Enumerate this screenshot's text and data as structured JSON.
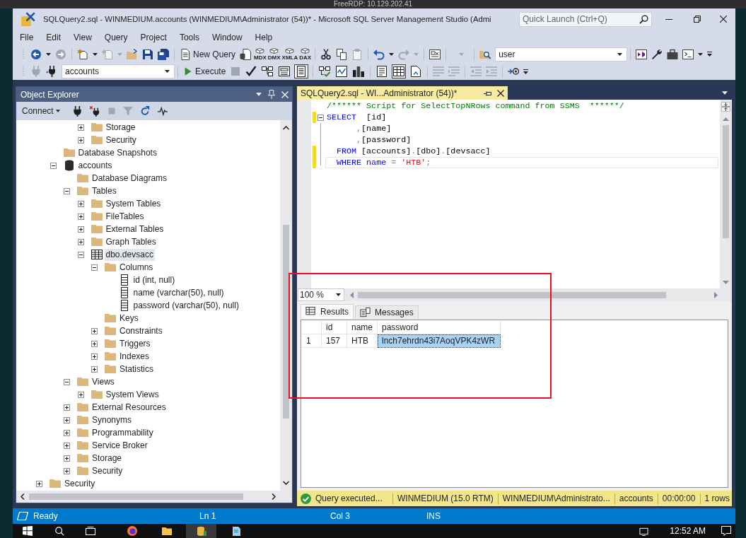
{
  "remote_session": {
    "title": "FreeRDP: 10.129.202.41"
  },
  "window": {
    "title": "SQLQuery2.sql - WINMEDIUM.accounts (WINMEDIUM\\Administrator (54))* - Microsoft SQL Server Management Studio (Admi",
    "quick_launch": {
      "placeholder": "Quick Launch (Ctrl+Q)"
    }
  },
  "menu": [
    "File",
    "Edit",
    "View",
    "Query",
    "Project",
    "Tools",
    "Window",
    "Help"
  ],
  "toolbar": {
    "new_query": "New Query",
    "script_types": [
      "MDX",
      "DMX",
      "XMLA",
      "DAX"
    ],
    "find_value": "user",
    "database": "accounts",
    "execute": "Execute",
    "toggle_groups": [
      {
        "buttons": [
          {
            "kind": "plan",
            "on": false
          },
          {
            "kind": "options",
            "on": false
          },
          {
            "kind": "intellisense",
            "on": true
          }
        ]
      },
      {
        "buttons": [
          {
            "kind": "actual_plan",
            "on": false
          },
          {
            "kind": "live_stats",
            "on": false
          },
          {
            "kind": "client_stats",
            "on": false
          }
        ]
      },
      {
        "buttons": [
          {
            "kind": "results_text",
            "on": false
          },
          {
            "kind": "results_grid",
            "on": true
          },
          {
            "kind": "results_file",
            "on": false
          }
        ]
      }
    ]
  },
  "object_explorer": {
    "title": "Object Explorer",
    "connect": "Connect",
    "tree": [
      {
        "children": [
          {
            "children": [
              {
                "children": [
                  {
                    "children": [
                      {
                        "label": "Storage",
                        "kind": "folder",
                        "expanded": false,
                        "selected": false
                      },
                      {
                        "label": "Security",
                        "kind": "folder",
                        "expanded": false,
                        "selected": false
                      }
                    ]
                  }
                ]
              },
              {
                "label": "Database Snapshots",
                "kind": "folder",
                "selected": false
              },
              {
                "label": "accounts",
                "kind": "database",
                "expanded": true,
                "selected": false,
                "children": [
                  {
                    "label": "Database Diagrams",
                    "kind": "folder",
                    "selected": false
                  },
                  {
                    "label": "Tables",
                    "kind": "folder",
                    "expanded": true,
                    "selected": false,
                    "children": [
                      {
                        "label": "System Tables",
                        "kind": "folder",
                        "expanded": false,
                        "selected": false
                      },
                      {
                        "label": "FileTables",
                        "kind": "folder",
                        "expanded": false,
                        "selected": false
                      },
                      {
                        "label": "External Tables",
                        "kind": "folder",
                        "expanded": false,
                        "selected": false
                      },
                      {
                        "label": "Graph Tables",
                        "kind": "folder",
                        "expanded": false,
                        "selected": false
                      },
                      {
                        "label": "dbo.devsacc",
                        "kind": "table",
                        "expanded": true,
                        "selected": true,
                        "children": [
                          {
                            "label": "Columns",
                            "kind": "folder",
                            "expanded": true,
                            "selected": false,
                            "children": [
                              {
                                "label": "id (int, null)",
                                "kind": "column",
                                "selected": false
                              },
                              {
                                "label": "name (varchar(50), null)",
                                "kind": "column",
                                "selected": false
                              },
                              {
                                "label": "password (varchar(50), null)",
                                "kind": "column",
                                "selected": false
                              }
                            ]
                          },
                          {
                            "label": "Keys",
                            "kind": "folder",
                            "selected": false
                          },
                          {
                            "label": "Constraints",
                            "kind": "folder",
                            "expanded": false,
                            "selected": false
                          },
                          {
                            "label": "Triggers",
                            "kind": "folder",
                            "expanded": false,
                            "selected": false
                          },
                          {
                            "label": "Indexes",
                            "kind": "folder",
                            "expanded": false,
                            "selected": false
                          },
                          {
                            "label": "Statistics",
                            "kind": "folder",
                            "expanded": false,
                            "selected": false
                          }
                        ]
                      }
                    ]
                  },
                  {
                    "label": "Views",
                    "kind": "folder",
                    "expanded": true,
                    "selected": false,
                    "children": [
                      {
                        "label": "System Views",
                        "kind": "folder",
                        "expanded": false,
                        "selected": false
                      }
                    ]
                  },
                  {
                    "label": "External Resources",
                    "kind": "folder",
                    "expanded": false,
                    "selected": false
                  },
                  {
                    "label": "Synonyms",
                    "kind": "folder",
                    "expanded": false,
                    "selected": false
                  },
                  {
                    "label": "Programmability",
                    "kind": "folder",
                    "expanded": false,
                    "selected": false
                  },
                  {
                    "label": "Service Broker",
                    "kind": "folder",
                    "expanded": false,
                    "selected": false
                  },
                  {
                    "label": "Storage",
                    "kind": "folder",
                    "expanded": false,
                    "selected": false
                  },
                  {
                    "label": "Security",
                    "kind": "folder",
                    "expanded": false,
                    "selected": false
                  }
                ]
              }
            ]
          },
          {
            "label": "Security",
            "kind": "folder",
            "expanded": false,
            "selected": false
          }
        ]
      }
    ]
  },
  "editor": {
    "tab": {
      "label": "SQLQuery2.sql - WI...Administrator (54))*",
      "selected": true
    },
    "lines": [
      {
        "kind": "plain",
        "changed": false,
        "current": false,
        "tokens": [
          {
            "text": "/****** Script for SelectTopNRows command from SSMS  ******/",
            "kind": "comment"
          }
        ]
      },
      {
        "kind": "fold_start",
        "changed": true,
        "current": false,
        "tokens": [
          {
            "text": "SELECT",
            "kind": "keyword"
          },
          {
            "text": "  [id]",
            "kind": "plain"
          }
        ]
      },
      {
        "kind": "fold_body",
        "changed": false,
        "current": false,
        "tokens": [
          {
            "text": "      ,",
            "kind": "punct"
          },
          {
            "text": "[name]",
            "kind": "plain"
          }
        ]
      },
      {
        "kind": "fold_body",
        "changed": false,
        "current": false,
        "tokens": [
          {
            "text": "      ,",
            "kind": "punct"
          },
          {
            "text": "[password]",
            "kind": "plain"
          }
        ]
      },
      {
        "kind": "fold_body",
        "changed": true,
        "current": false,
        "tokens": [
          {
            "text": "  FROM",
            "kind": "keyword"
          },
          {
            "text": " [accounts]",
            "kind": "plain"
          },
          {
            "text": ".",
            "kind": "punct"
          },
          {
            "text": "[dbo]",
            "kind": "plain"
          },
          {
            "text": ".",
            "kind": "punct"
          },
          {
            "text": "[devsacc]",
            "kind": "plain"
          }
        ]
      },
      {
        "kind": "fold_end",
        "changed": true,
        "current": true,
        "tokens": [
          {
            "text": "  WHERE name",
            "kind": "keyword"
          },
          {
            "text": " =",
            "kind": "punct"
          },
          {
            "text": " 'HTB'",
            "kind": "string"
          },
          {
            "text": ";",
            "kind": "punct"
          }
        ]
      }
    ],
    "zoom": "100 %"
  },
  "results": {
    "tabs": [
      {
        "label": "Results",
        "kind": "grid",
        "selected": true
      },
      {
        "label": "Messages",
        "kind": "messages",
        "selected": false
      }
    ],
    "columns": [
      "id",
      "name",
      "password"
    ],
    "rows": [
      {
        "number": "1",
        "cells": [
          {
            "text": "157",
            "selected": false
          },
          {
            "text": "HTB",
            "selected": false
          },
          {
            "text": "lnch7ehrdn43i7AoqVPK4zWR",
            "selected": true
          }
        ]
      }
    ]
  },
  "query_status": {
    "message": "Query executed...",
    "fields": [
      "WINMEDIUM (15.0 RTM)",
      "WINMEDIUM\\Administrato...",
      "accounts",
      "00:00:00",
      "1 rows"
    ]
  },
  "status_bar": {
    "state": "Ready",
    "line": "Ln 1",
    "column": "Col 3",
    "mode": "INS"
  },
  "taskbar": {
    "apps": [
      {
        "kind": "browser",
        "selected": false
      },
      {
        "kind": "folder",
        "selected": false
      },
      {
        "kind": "database",
        "selected": true
      },
      {
        "kind": "notepad",
        "selected": false
      }
    ],
    "clock": "12:52 AM"
  }
}
